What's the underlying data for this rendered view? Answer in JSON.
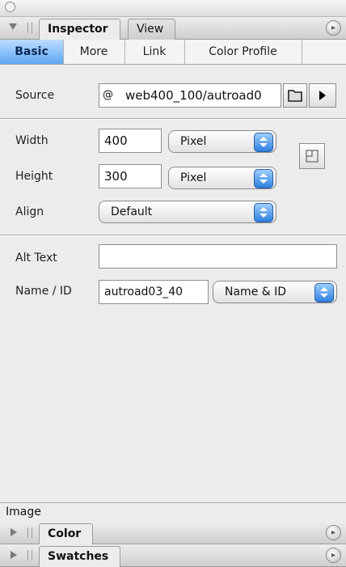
{
  "palette": {
    "tabs": [
      {
        "label": "Inspector",
        "active": true
      },
      {
        "label": "View",
        "active": false
      }
    ]
  },
  "subtabs": [
    {
      "label": "Basic",
      "active": true
    },
    {
      "label": "More",
      "active": false
    },
    {
      "label": "Link",
      "active": false
    },
    {
      "label": "Color Profile",
      "active": false
    }
  ],
  "source": {
    "label": "Source",
    "value": "web400_100/autroad0",
    "at_symbol": "@"
  },
  "width": {
    "label": "Width",
    "value": "400",
    "unit": "Pixel"
  },
  "height": {
    "label": "Height",
    "value": "300",
    "unit": "Pixel"
  },
  "align": {
    "label": "Align",
    "value": "Default"
  },
  "alt_text": {
    "label": "Alt Text",
    "value": ""
  },
  "name_id": {
    "label": "Name / ID",
    "value": "autroad03_40",
    "mode": "Name & ID"
  },
  "status": {
    "text": "Image"
  },
  "collapsed_palettes": [
    {
      "label": "Color"
    },
    {
      "label": "Swatches"
    }
  ],
  "colors": {
    "accent": "#4a9cf2",
    "background": "#ececec"
  }
}
